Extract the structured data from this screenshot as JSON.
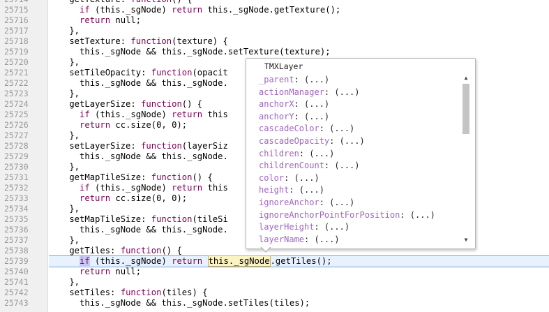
{
  "lines": [
    {
      "n": "25714",
      "t": "    getTexture: function() {"
    },
    {
      "n": "25715",
      "t": "      if (this._sgNode) return this._sgNode.getTexture();"
    },
    {
      "n": "25716",
      "t": "      return null;"
    },
    {
      "n": "25717",
      "t": "    },"
    },
    {
      "n": "25718",
      "t": "    setTexture: function(texture) {"
    },
    {
      "n": "25719",
      "t": "      this._sgNode && this._sgNode.setTexture(texture);"
    },
    {
      "n": "25720",
      "t": "    },"
    },
    {
      "n": "25721",
      "t": "    setTileOpacity: function(opacit"
    },
    {
      "n": "25722",
      "t": "      this._sgNode && this._sgNode."
    },
    {
      "n": "25723",
      "t": "    },"
    },
    {
      "n": "25724",
      "t": "    getLayerSize: function() {"
    },
    {
      "n": "25725",
      "t": "      if (this._sgNode) return this"
    },
    {
      "n": "25726",
      "t": "      return cc.size(0, 0);"
    },
    {
      "n": "25727",
      "t": "    },"
    },
    {
      "n": "25728",
      "t": "    setLayerSize: function(layerSiz"
    },
    {
      "n": "25729",
      "t": "      this._sgNode && this._sgNode."
    },
    {
      "n": "25730",
      "t": "    },"
    },
    {
      "n": "25731",
      "t": "    getMapTileSize: function() {"
    },
    {
      "n": "25732",
      "t": "      if (this._sgNode) return this"
    },
    {
      "n": "25733",
      "t": "      return cc.size(0, 0);"
    },
    {
      "n": "25734",
      "t": "    },"
    },
    {
      "n": "25735",
      "t": "    setMapTileSize: function(tileSi"
    },
    {
      "n": "25736",
      "t": "      this._sgNode && this._sgNode."
    },
    {
      "n": "25737",
      "t": "    },"
    },
    {
      "n": "25738",
      "t": "    getTiles: function() {"
    },
    {
      "n": "25739",
      "t": "",
      "active": true
    },
    {
      "n": "25740",
      "t": "      return null;"
    },
    {
      "n": "25741",
      "t": "    },"
    },
    {
      "n": "25742",
      "t": "    setTiles: function(tiles) {"
    },
    {
      "n": "25743",
      "t": "      this._sgNode && this._sgNode.setTiles(tiles);"
    }
  ],
  "active_line": {
    "indent": "      ",
    "kw_if": "if",
    "mid": " (this._sgNode) return ",
    "match": "this._sgNode",
    "tail": ".getTiles();"
  },
  "popup": {
    "title": "TMXLayer",
    "items": [
      {
        "name": "_parent",
        "rest": ": (...)"
      },
      {
        "name": "actionManager",
        "rest": ": (...)"
      },
      {
        "name": "anchorX",
        "rest": ": (...)"
      },
      {
        "name": "anchorY",
        "rest": ": (...)"
      },
      {
        "name": "cascadeColor",
        "rest": ": (...)"
      },
      {
        "name": "cascadeOpacity",
        "rest": ": (...)"
      },
      {
        "name": "children",
        "rest": ": (...)"
      },
      {
        "name": "childrenCount",
        "rest": ": (...)"
      },
      {
        "name": "color",
        "rest": ": (...)"
      },
      {
        "name": "height",
        "rest": ": (...)"
      },
      {
        "name": "ignoreAnchor",
        "rest": ": (...)"
      },
      {
        "name": "ignoreAnchorPointForPosition",
        "rest": ": (...)"
      },
      {
        "name": "layerHeight",
        "rest": ": (...)"
      },
      {
        "name": "layerName",
        "rest": ": (...)"
      }
    ],
    "scroll_up_icon": "triangle-up",
    "scroll_down_icon": "triangle-down"
  }
}
